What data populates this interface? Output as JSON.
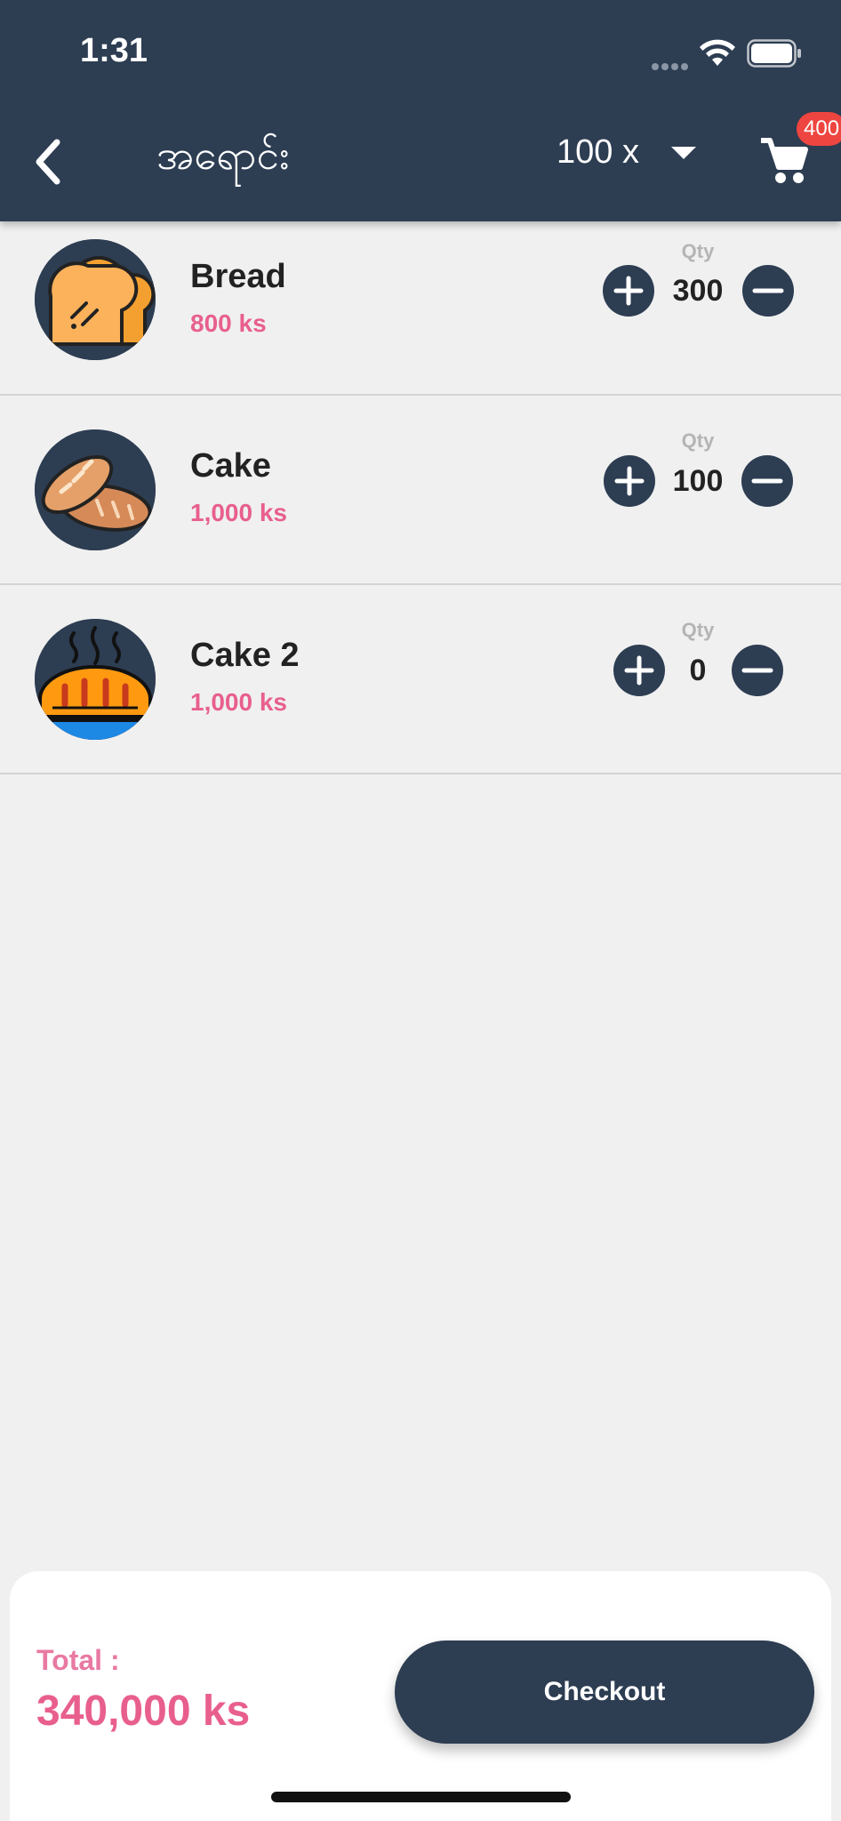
{
  "status_bar": {
    "time": "1:31"
  },
  "header": {
    "title": "အရောင်း",
    "multiplier": "100 x",
    "cart_badge": "400",
    "back_icon": "chevron-left-icon",
    "cart_icon": "cart-icon"
  },
  "items": [
    {
      "name": "Bread",
      "price": "800 ks",
      "qty_label": "Qty",
      "qty": "300",
      "image": "toast-icon"
    },
    {
      "name": "Cake",
      "price": "1,000 ks",
      "qty_label": "Qty",
      "qty": "100",
      "image": "baguette-icon"
    },
    {
      "name": "Cake 2",
      "price": "1,000 ks",
      "qty_label": "Qty",
      "qty": "0",
      "image": "hot-bread-icon"
    }
  ],
  "footer": {
    "total_label": "Total :",
    "total_value": "340,000 ks",
    "checkout_label": "Checkout"
  },
  "colors": {
    "primary": "#2d3d52",
    "accent_pink": "#e85f8e",
    "badge_red": "#ef4540",
    "background": "#f0f0f0"
  }
}
